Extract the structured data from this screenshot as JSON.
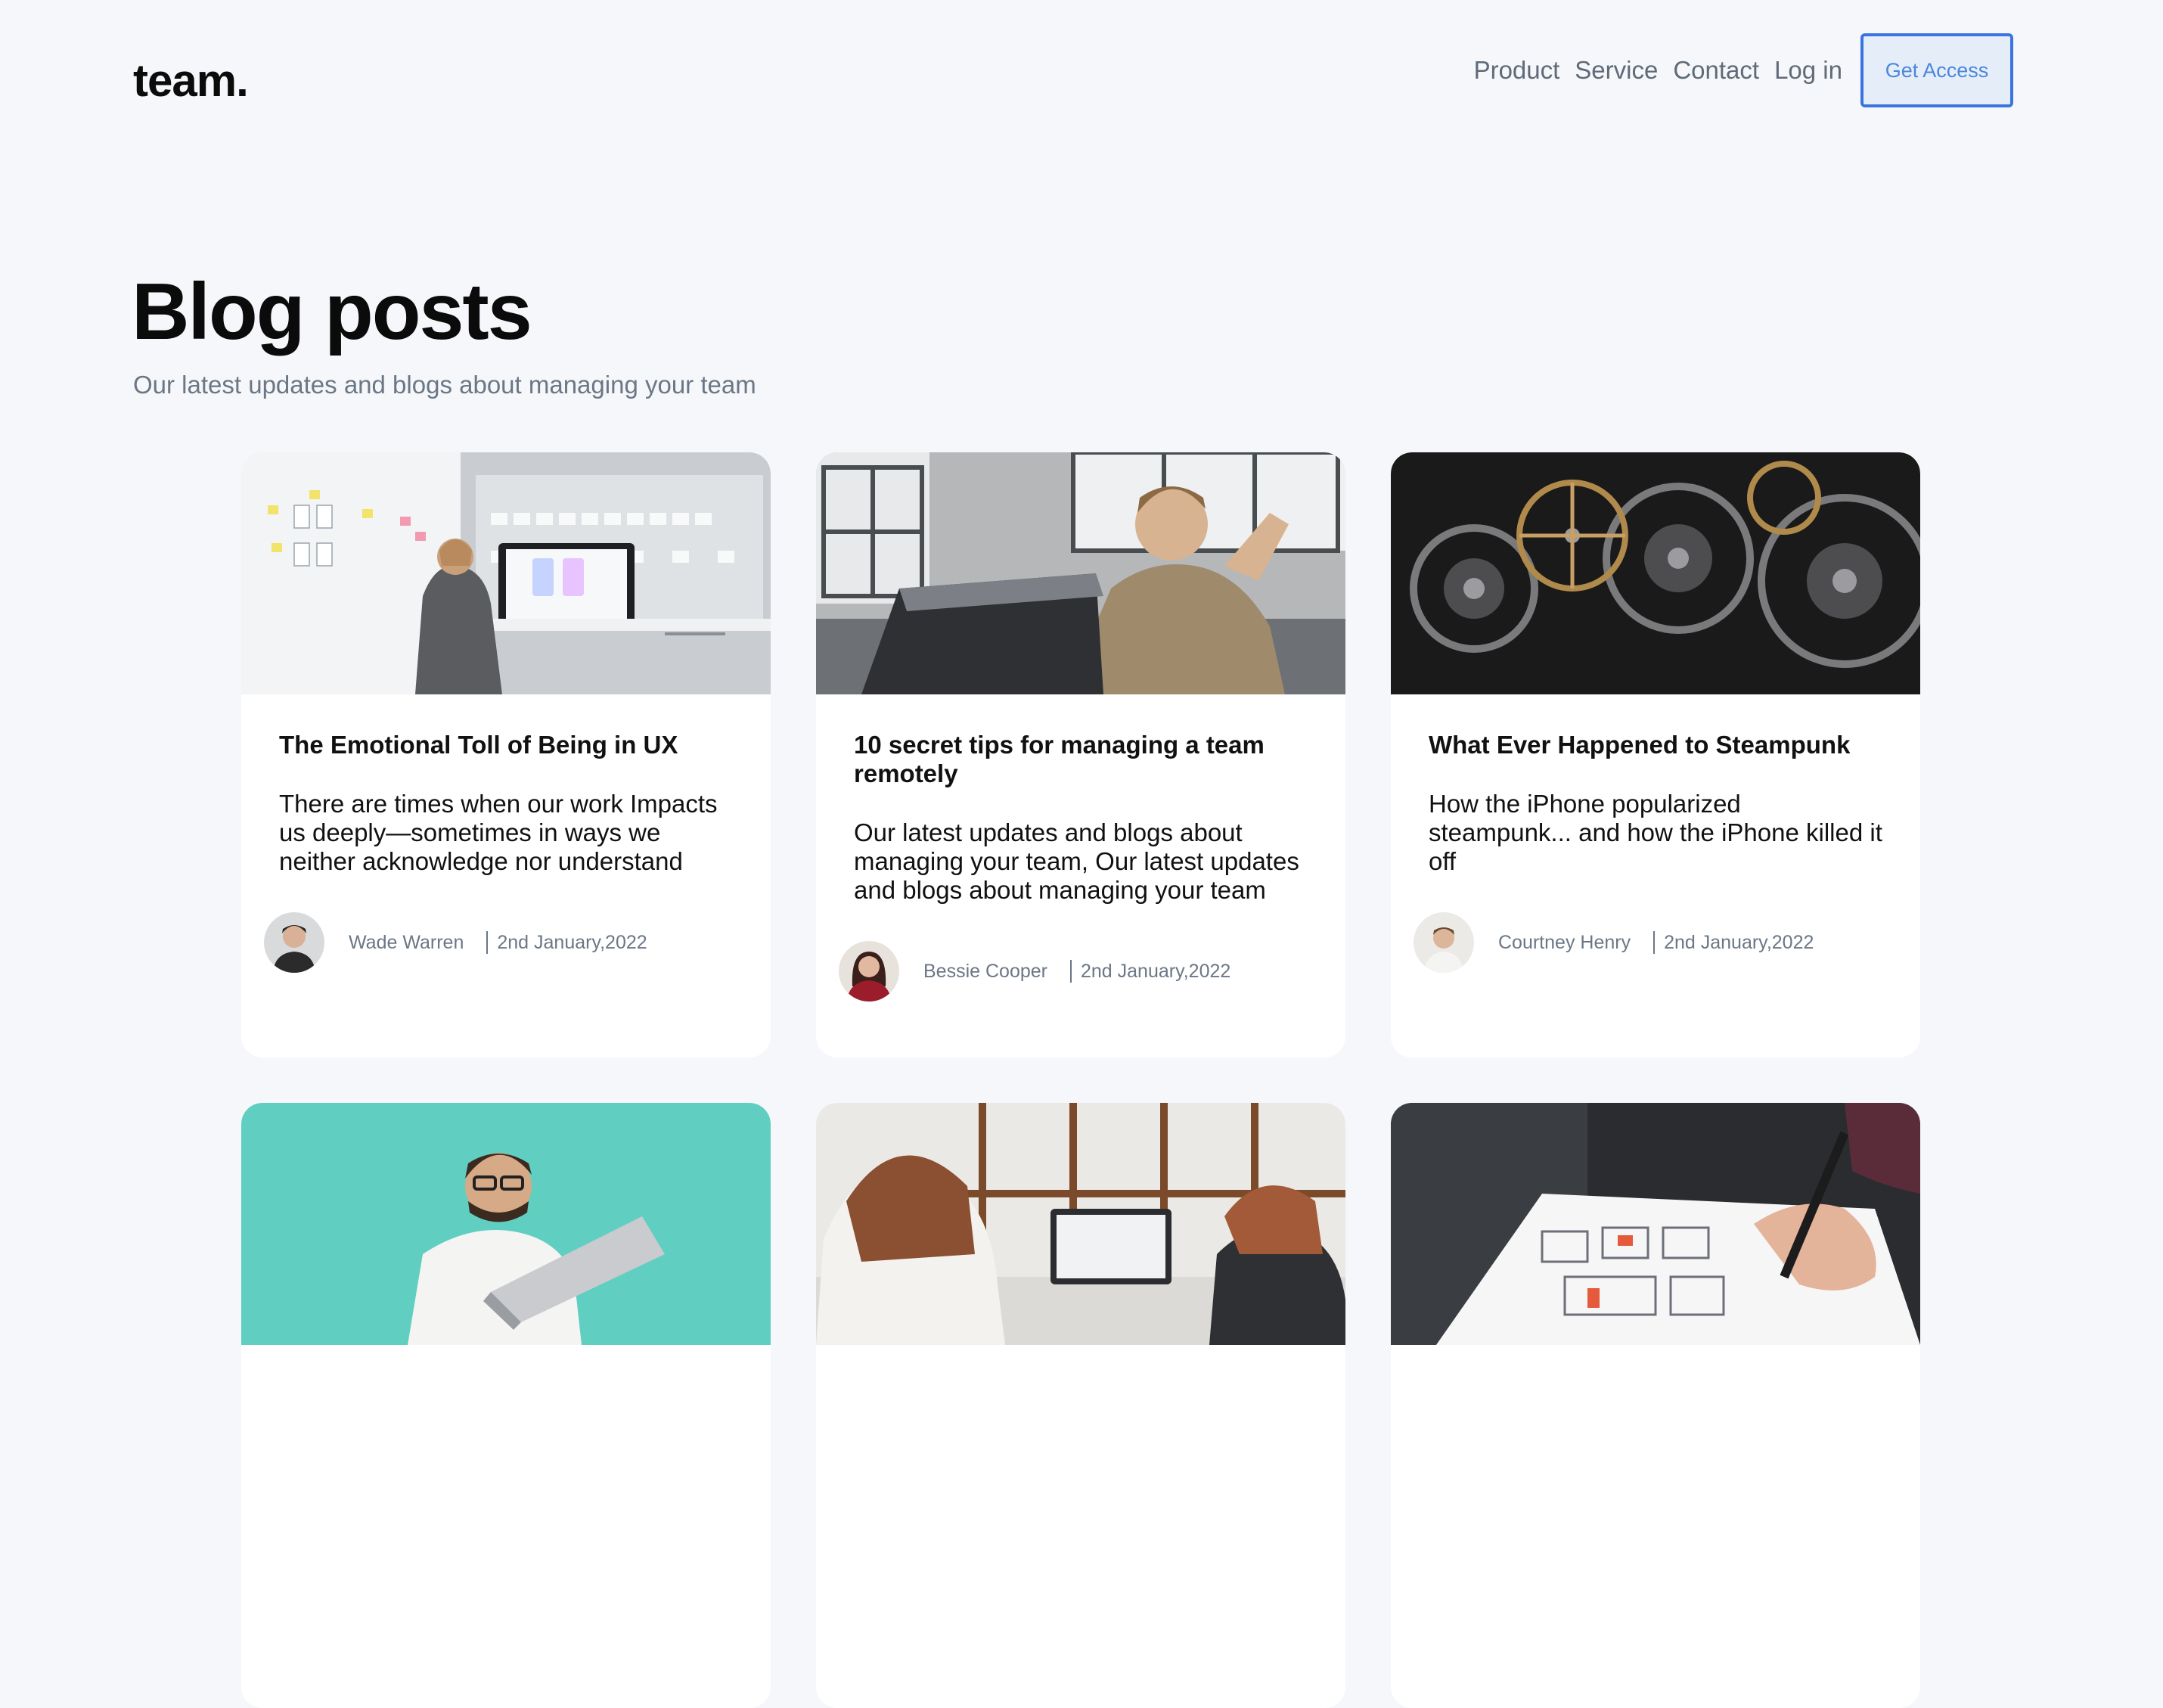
{
  "brand": {
    "logo": "team."
  },
  "nav": {
    "links": [
      "Product",
      "Service",
      "Contact",
      "Log in"
    ],
    "cta": "Get Access"
  },
  "hero": {
    "title": "Blog posts",
    "subtitle": "Our latest updates and blogs about managing your team"
  },
  "posts": [
    {
      "title": "The Emotional Toll of Being in UX",
      "excerpt": "There are times when our work Impacts us deeply—sometimes in ways we neither acknowledge nor understand",
      "author": "Wade Warren",
      "date": "2nd January,2022",
      "image": "woman-at-desk-photo"
    },
    {
      "title": "10 secret tips for managing a team remotely",
      "excerpt": "Our latest updates and blogs about managing your team, Our latest updates and blogs about managing your team",
      "author": "Bessie Cooper",
      "date": "2nd January,2022",
      "image": "man-with-laptop-photo"
    },
    {
      "title": "What Ever Happened to Steampunk",
      "excerpt": "How the iPhone popularized steampunk... and how the iPhone killed it off",
      "author": "Courtney Henry",
      "date": "2nd January,2022",
      "image": "gears-photo"
    },
    {
      "image": "man-holding-laptop-photo"
    },
    {
      "image": "two-women-laptop-photo"
    },
    {
      "image": "hand-sketching-wireframe-photo"
    }
  ],
  "colors": {
    "background": "#f5f7fa",
    "accent": "#3b74e0",
    "muted_text": "#6b7785"
  }
}
